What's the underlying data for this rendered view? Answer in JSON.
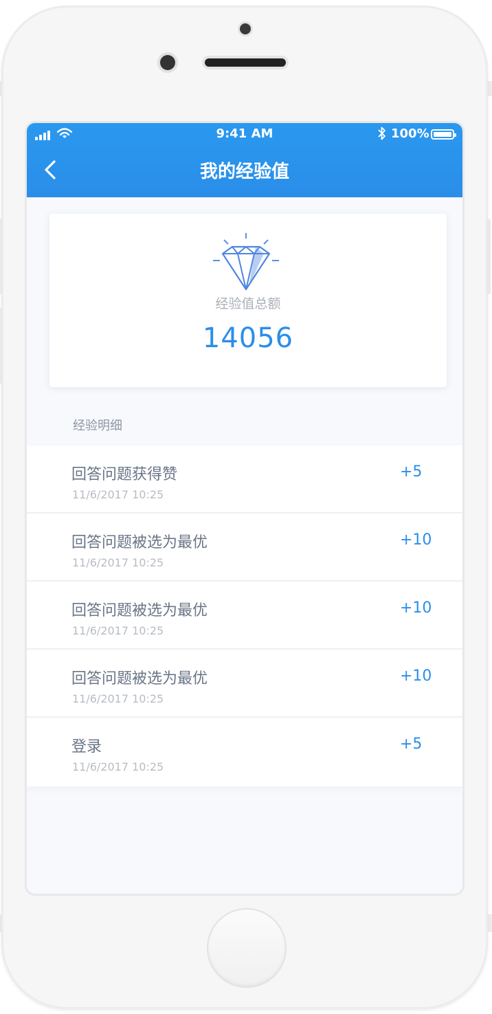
{
  "status_bar": {
    "time": "9:41 AM",
    "battery": "100%"
  },
  "header": {
    "title": "我的经验值"
  },
  "summary": {
    "label": "经验值总额",
    "total": "14056"
  },
  "section": {
    "label": "经验明细"
  },
  "entries": [
    {
      "title": "回答问题获得赞",
      "time": "11/6/2017  10:25",
      "points": "+5"
    },
    {
      "title": "回答问题被选为最优",
      "time": "11/6/2017  10:25",
      "points": "+10"
    },
    {
      "title": "回答问题被选为最优",
      "time": "11/6/2017  10:25",
      "points": "+10"
    },
    {
      "title": "回答问题被选为最优",
      "time": "11/6/2017  10:25",
      "points": "+10"
    },
    {
      "title": "登录",
      "time": "11/6/2017  10:25",
      "points": "+5"
    }
  ],
  "colors": {
    "accent": "#2a8ee9",
    "header": "#2a98ef",
    "background": "#f7f9fc"
  }
}
